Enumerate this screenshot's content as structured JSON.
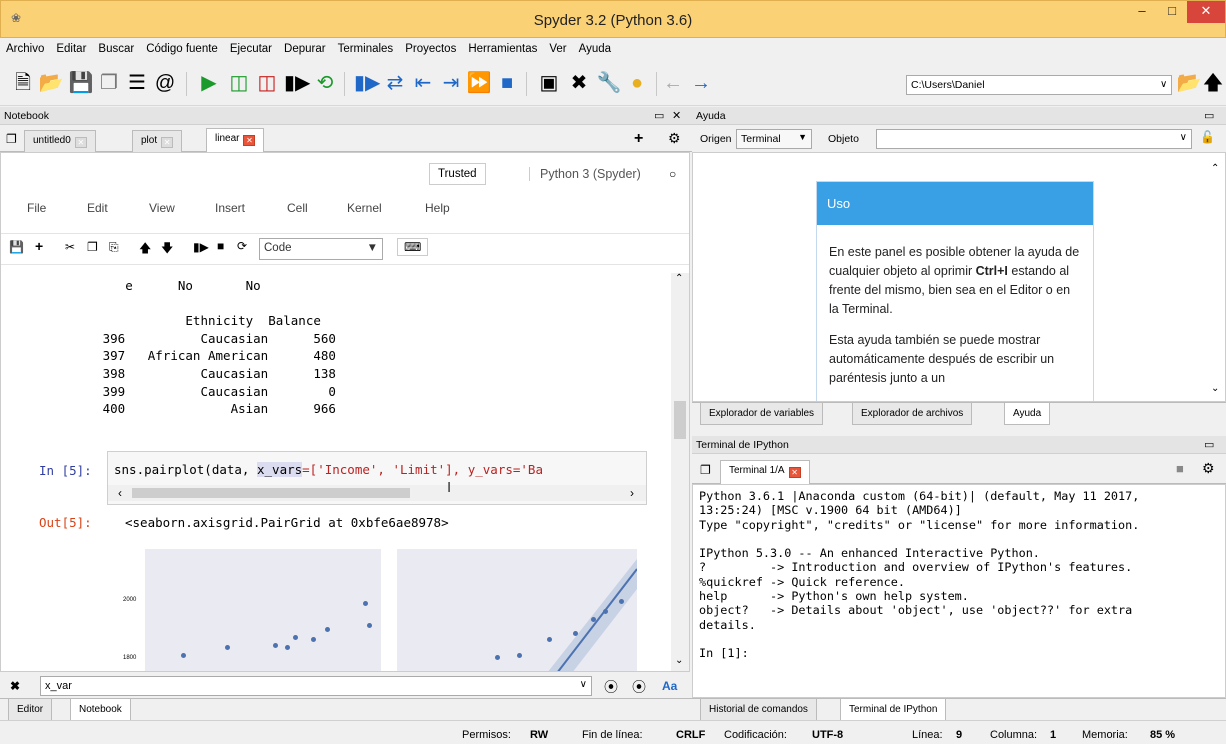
{
  "window": {
    "title": "Spyder 3.2 (Python 3.6)",
    "minimize": "–",
    "maximize": "□",
    "close": "✕"
  },
  "menu": [
    "Archivo",
    "Editar",
    "Buscar",
    "Código fuente",
    "Ejecutar",
    "Depurar",
    "Terminales",
    "Proyectos",
    "Herramientas",
    "Ver",
    "Ayuda"
  ],
  "toolbar": {
    "path": "C:\\Users\\Daniel"
  },
  "notebook_pane": {
    "title": "Notebook",
    "tabs": [
      "untitled0",
      "plot",
      "linear"
    ],
    "trusted": "Trusted",
    "kernel": "Python 3 (Spyder)",
    "menu": [
      "File",
      "Edit",
      "View",
      "Insert",
      "Cell",
      "Kernel",
      "Help"
    ],
    "celltype": "Code",
    "output_lines": [
      "        e      No       No",
      "",
      "                Ethnicity  Balance",
      "     396          Caucasian      560",
      "     397   African American      480",
      "     398          Caucasian      138",
      "     399          Caucasian        0",
      "     400              Asian      966"
    ],
    "in_prompt": "In [5]:",
    "code_pre": "sns.pairplot(data, ",
    "code_hl": "x_vars",
    "code_post": "=['Income', 'Limit'], y_vars='Ba",
    "out_prompt": "Out[5]:",
    "out_text": "<seaborn.axisgrid.PairGrid at 0xbfe6ae8978>",
    "plot_label_2000": "2000",
    "plot_label_1800": "1800"
  },
  "find": {
    "value": "x_var",
    "aa": "Aa"
  },
  "left_bottom_tabs": [
    "Editor",
    "Notebook"
  ],
  "help_pane": {
    "title": "Ayuda",
    "origen_label": "Origen",
    "origen_value": "Terminal",
    "objeto_label": "Objeto",
    "card_title": "Uso",
    "p1_a": "En este panel es posible obtener la ayuda de cualquier objeto al oprimir ",
    "p1_b": "Ctrl+I",
    "p1_c": " estando al frente del mismo, bien sea en el Editor o en la Terminal.",
    "p2": "Esta ayuda también se puede mostrar automáticamente después de escribir un paréntesis junto a un",
    "tabs": [
      "Explorador de variables",
      "Explorador de archivos",
      "Ayuda"
    ]
  },
  "ipython_pane": {
    "title": "Terminal de IPython",
    "tab": "Terminal 1/A",
    "output": "Python 3.6.1 |Anaconda custom (64-bit)| (default, May 11 2017,\n13:25:24) [MSC v.1900 64 bit (AMD64)]\nType \"copyright\", \"credits\" or \"license\" for more information.\n\nIPython 5.3.0 -- An enhanced Interactive Python.\n?         -> Introduction and overview of IPython's features.\n%quickref -> Quick reference.\nhelp      -> Python's own help system.\nobject?   -> Details about 'object', use 'object??' for extra\ndetails.\n\nIn [1]:",
    "tabs": [
      "Historial de comandos",
      "Terminal de IPython"
    ]
  },
  "status": {
    "permisos_label": "Permisos:",
    "permisos": "RW",
    "fin_label": "Fin de línea:",
    "fin": "CRLF",
    "cod_label": "Codificación:",
    "cod": "UTF-8",
    "linea_label": "Línea:",
    "linea": "9",
    "col_label": "Columna:",
    "col": "1",
    "mem_label": "Memoria:",
    "mem": "85 %"
  }
}
